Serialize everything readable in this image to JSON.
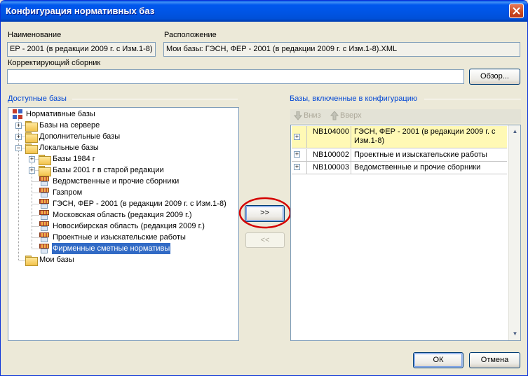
{
  "window": {
    "title": "Конфигурация нормативных баз"
  },
  "fields": {
    "name_label": "Наименование",
    "name_value": "ЕР - 2001 (в редакции 2009 г. с Изм.1-8)",
    "location_label": "Расположение",
    "location_value": "Мои базы: ГЭСН, ФЕР - 2001 (в редакции 2009 г. с Изм.1-8).XML",
    "corr_label": "Корректирующий сборник",
    "corr_value": "",
    "browse_button": "Обзор..."
  },
  "left": {
    "label": "Доступные базы",
    "tree": [
      {
        "label": "Нормативные базы",
        "icon": "grid-icon"
      },
      {
        "label": "Базы на сервере",
        "icon": "folder-icon",
        "expander": "+"
      },
      {
        "label": "Дополнительные базы",
        "icon": "folder-icon",
        "expander": "+"
      },
      {
        "label": "Локальные базы",
        "icon": "folder-icon",
        "expander": "−"
      },
      {
        "label": "Базы 1984 г",
        "icon": "folder-icon",
        "expander": "+"
      },
      {
        "label": "Базы 2001 г в старой редакции",
        "icon": "folder-icon",
        "expander": "+"
      },
      {
        "label": "Ведомственные и прочие сборники",
        "icon": "database-icon"
      },
      {
        "label": "Газпром",
        "icon": "database-icon"
      },
      {
        "label": "ГЭСН, ФЕР - 2001 (в редакции 2009 г. с Изм.1-8)",
        "icon": "database-icon"
      },
      {
        "label": "Московская область (редакция 2009 г.)",
        "icon": "database-icon"
      },
      {
        "label": "Новосибирская область (редакция 2009 г.)",
        "icon": "database-icon"
      },
      {
        "label": "Проектные и изыскательские работы",
        "icon": "database-icon"
      },
      {
        "label": "Фирменные сметные нормативы",
        "icon": "database-icon",
        "selected": true
      },
      {
        "label": "Мои базы",
        "icon": "folder-icon"
      }
    ]
  },
  "middle": {
    "add_button": ">>",
    "remove_button": "<<"
  },
  "right": {
    "label": "Базы, включенные в конфигурацию",
    "down_button": "Вниз",
    "up_button": "Вверх",
    "rows": [
      {
        "code": "NB104000",
        "name": "ГЭСН, ФЕР - 2001 (в редакции 2009 г. с Изм.1-8)",
        "selected": true
      },
      {
        "code": "NB100002",
        "name": "Проектные и изыскательские работы"
      },
      {
        "code": "NB100003",
        "name": "Ведомственные и прочие сборники"
      }
    ]
  },
  "footer": {
    "ok_button": "ОК",
    "cancel_button": "Отмена"
  },
  "colors": {
    "titlebar": "#0054e3",
    "selection": "#316ac5",
    "selected_row": "#fff9b5",
    "section_label": "#0046d5",
    "annotation_circle": "#d40000"
  }
}
